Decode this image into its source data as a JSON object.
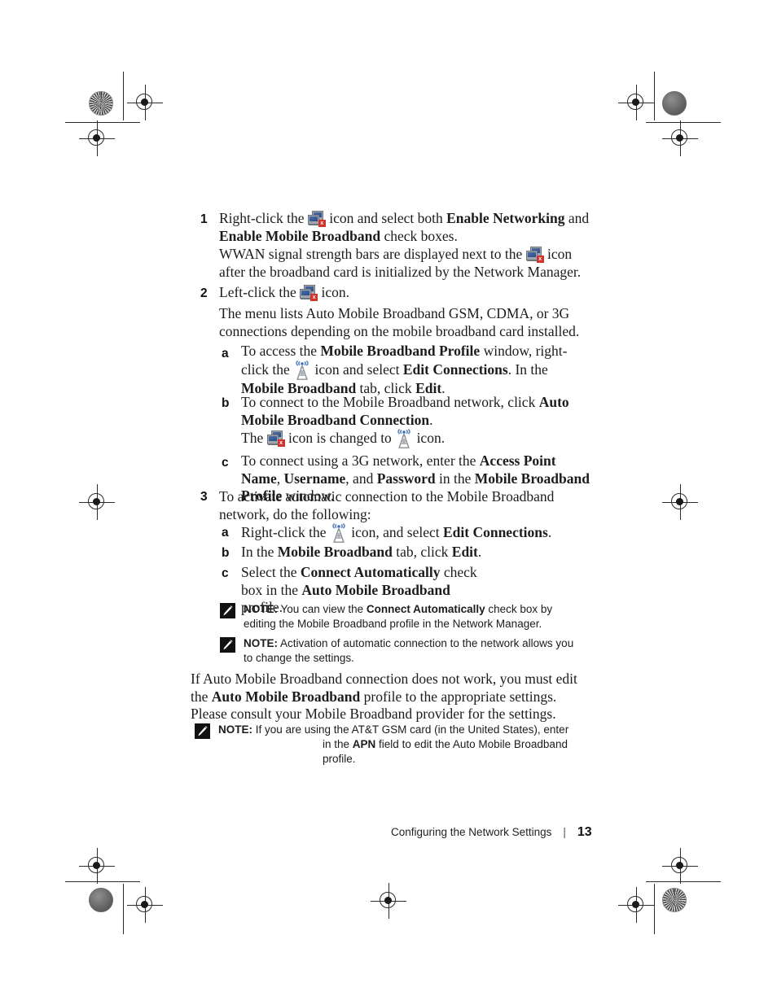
{
  "document": {
    "page_number": "13",
    "footer_title": "Configuring the Network Settings",
    "footer_separator": "|"
  },
  "icons": {
    "network": "network-monitors-icon",
    "network_badge": "x",
    "tower": "broadcast-tower-icon",
    "note": "note-pencil-icon"
  },
  "steps": [
    {
      "marker": "1",
      "parts": [
        {
          "t": "text",
          "v": "Right-click the "
        },
        {
          "t": "icon",
          "v": "network"
        },
        {
          "t": "text",
          "v": " icon and select both "
        },
        {
          "t": "bold",
          "v": "Enable Networking"
        },
        {
          "t": "text",
          "v": " and "
        },
        {
          "t": "bold",
          "v": "Enable Mobile Broadband"
        },
        {
          "t": "text",
          "v": " check boxes."
        }
      ]
    },
    {
      "marker": "",
      "parts": [
        {
          "t": "text",
          "v": "WWAN signal strength bars are displayed next to the "
        },
        {
          "t": "icon",
          "v": "network"
        },
        {
          "t": "text",
          "v": " icon after the broadband card is initialized by the Network Manager."
        }
      ]
    },
    {
      "marker": "2",
      "parts": [
        {
          "t": "text",
          "v": "Left-click the "
        },
        {
          "t": "icon",
          "v": "network"
        },
        {
          "t": "text",
          "v": " icon."
        }
      ]
    },
    {
      "marker": "",
      "parts": [
        {
          "t": "text",
          "v": "The menu lists Auto Mobile Broadband GSM, CDMA, or 3G connections depending on the mobile broadband card installed."
        }
      ]
    },
    {
      "marker": "a",
      "parts": [
        {
          "t": "text",
          "v": "To access the "
        },
        {
          "t": "bold",
          "v": "Mobile Broadband Profile"
        },
        {
          "t": "text",
          "v": " window, right-click the "
        },
        {
          "t": "icon",
          "v": "tower"
        },
        {
          "t": "text",
          "v": " icon and select "
        },
        {
          "t": "bold",
          "v": "Edit Connections"
        },
        {
          "t": "text",
          "v": ". In the "
        },
        {
          "t": "bold",
          "v": "Mobile Broadband"
        },
        {
          "t": "text",
          "v": " tab, click "
        },
        {
          "t": "bold",
          "v": "Edit"
        },
        {
          "t": "text",
          "v": "."
        }
      ]
    },
    {
      "marker": "b",
      "parts": [
        {
          "t": "text",
          "v": "To connect to the Mobile Broadband network, click "
        },
        {
          "t": "bold",
          "v": "Auto Mobile Broadband Connection"
        },
        {
          "t": "text",
          "v": "."
        }
      ]
    },
    {
      "marker": "",
      "parts": [
        {
          "t": "text",
          "v": "The "
        },
        {
          "t": "icon",
          "v": "network"
        },
        {
          "t": "text",
          "v": " icon is changed to "
        },
        {
          "t": "icon",
          "v": "tower"
        },
        {
          "t": "text",
          "v": " icon."
        }
      ]
    },
    {
      "marker": "c",
      "parts": [
        {
          "t": "text",
          "v": "To connect using a 3G network, enter the "
        },
        {
          "t": "bold",
          "v": "Access Point Name"
        },
        {
          "t": "text",
          "v": ", "
        },
        {
          "t": "bold",
          "v": "Username"
        },
        {
          "t": "text",
          "v": ", and "
        },
        {
          "t": "bold",
          "v": "Password"
        },
        {
          "t": "text",
          "v": " in the "
        },
        {
          "t": "bold",
          "v": "Mobile Broadband Profile"
        },
        {
          "t": "text",
          "v": " window."
        }
      ]
    },
    {
      "marker": "3",
      "parts": [
        {
          "t": "text",
          "v": "To activate automatic connection to the Mobile Broadband network, do the following:"
        }
      ]
    },
    {
      "marker": "a",
      "parts": [
        {
          "t": "text",
          "v": "Right-click the "
        },
        {
          "t": "icon",
          "v": "tower"
        },
        {
          "t": "text",
          "v": " icon, and select "
        },
        {
          "t": "bold",
          "v": "Edit Connections"
        },
        {
          "t": "text",
          "v": "."
        }
      ]
    },
    {
      "marker": "b",
      "parts": [
        {
          "t": "text",
          "v": "In the "
        },
        {
          "t": "bold",
          "v": "Mobile Broadband"
        },
        {
          "t": "text",
          "v": " tab, click "
        },
        {
          "t": "bold",
          "v": "Edit"
        },
        {
          "t": "text",
          "v": "."
        }
      ]
    },
    {
      "marker": "c",
      "parts": [
        {
          "t": "text",
          "v": "Select the "
        },
        {
          "t": "bold",
          "v": "Connect Automatically"
        },
        {
          "t": "text",
          "v": " check box in the "
        },
        {
          "t": "bold",
          "v": "Auto Mobile Broadband"
        },
        {
          "t": "text",
          "v": " profile."
        }
      ]
    }
  ],
  "notes": [
    {
      "label": "NOTE:",
      "parts": [
        {
          "t": "text",
          "v": " You can view the "
        },
        {
          "t": "bold",
          "v": "Connect Automatically"
        },
        {
          "t": "text",
          "v": " check box by editing the Mobile Broadband profile in the Network Manager."
        }
      ]
    },
    {
      "label": "NOTE:",
      "parts": [
        {
          "t": "text",
          "v": " Activation of automatic connection to the network allows you to change the settings."
        }
      ]
    }
  ],
  "closing_paragraph": {
    "parts": [
      {
        "t": "text",
        "v": "If Auto Mobile Broadband connection does not work, you must edit the "
      },
      {
        "t": "bold",
        "v": "Auto Mobile Broadband"
      },
      {
        "t": "text",
        "v": " profile to the appropriate settings. Please consult your Mobile Broadband provider for the settings."
      }
    ]
  },
  "final_note": {
    "label": "NOTE:",
    "line1": " If you are using the AT&T GSM card (in the United States), enter",
    "line2_gap": "",
    "line2_parts": [
      {
        "t": "text",
        "v": "in the "
      },
      {
        "t": "bold",
        "v": "APN"
      },
      {
        "t": "text",
        "v": " field to edit the Auto Mobile Broadband profile."
      }
    ]
  }
}
